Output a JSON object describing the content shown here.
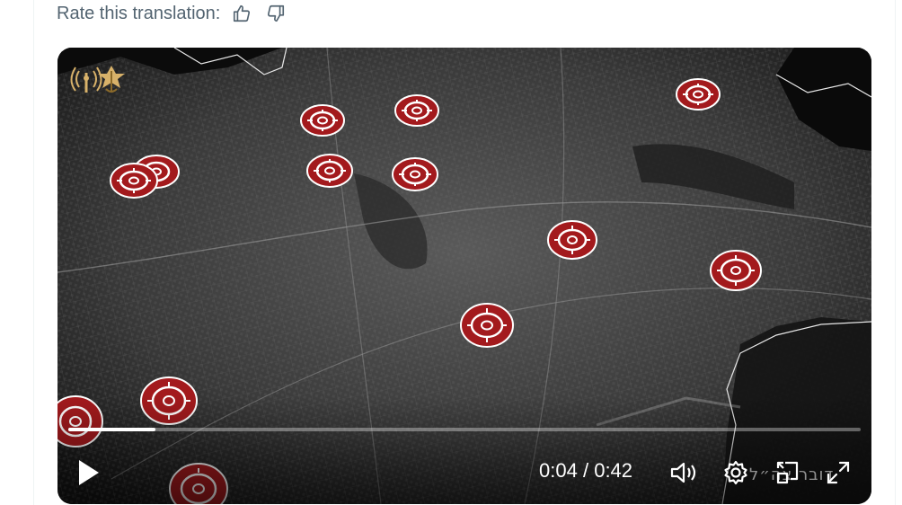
{
  "translation": {
    "rate_label": "Rate this translation:",
    "thumbs_up_icon": "thumbs-up-icon",
    "thumbs_down_icon": "thumbs-down-icon"
  },
  "video": {
    "current_time": "0:04",
    "separator": "/",
    "duration": "0:42",
    "progress_fraction": 0.11,
    "watermark_text": "דובר צה״ל",
    "logo_icon": "idf-emblem-icon",
    "target_icon": "target-marker-icon",
    "controls": {
      "play_icon": "play-icon",
      "volume_icon": "volume-icon",
      "settings_icon": "gear-icon",
      "pip_icon": "picture-in-picture-icon",
      "fullscreen_icon": "fullscreen-icon"
    },
    "accent_color": "#a31a1d"
  }
}
